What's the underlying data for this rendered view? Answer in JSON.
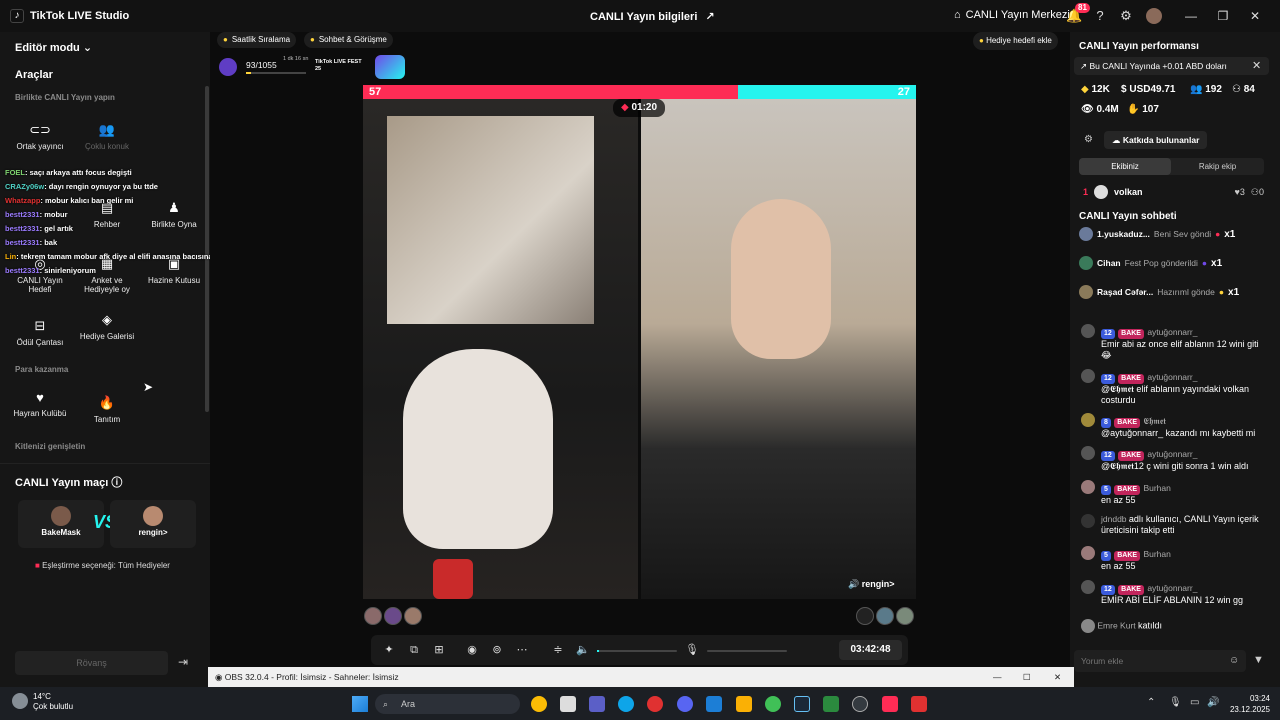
{
  "titlebar": {
    "app_title": "TikTok LIVE Studio",
    "live_info": "CANLI Yayın bilgileri",
    "live_center": "CANLI Yayın Merkezi",
    "notif_count": "81"
  },
  "left": {
    "editor_mode": "Editör modu",
    "tools_heading": "Araçlar",
    "section_live_together": "Birlikte CANLI Yayın yapın",
    "tools": [
      {
        "label": "Ortak yayıncı",
        "icon": "co-host-icon"
      },
      {
        "label": "Çoklu konuk",
        "icon": "multi-guest-icon"
      },
      {
        "label": "Rehber",
        "icon": "guide-icon"
      },
      {
        "label": "Birlikte Oyna",
        "icon": "play-together-icon"
      },
      {
        "label": "CANLI Yayın Hedefi",
        "icon": "live-goal-icon"
      },
      {
        "label": "Anket ve Hediyeyle oy",
        "icon": "poll-icon"
      },
      {
        "label": "Hazine Kutusu",
        "icon": "treasure-box-icon"
      },
      {
        "label": "Ödül Çantası",
        "icon": "reward-bag-icon"
      },
      {
        "label": "Hediye Galerisi",
        "icon": "gift-gallery-icon"
      },
      {
        "label": "Hayran Kulübü",
        "icon": "fan-club-icon"
      },
      {
        "label": "Tanıtım",
        "icon": "promote-icon"
      }
    ],
    "section_monetization": "Para kazanma",
    "section_expand": "Kitlenizi genişletin",
    "overlay_chat": [
      {
        "name": "FOEL",
        "text": ": saçı arkaya attı focus degişti"
      },
      {
        "name": "CRAZy06w",
        "text": ": dayı rengin oynuyor ya bu ttde"
      },
      {
        "name": "Whatzapp",
        "text": ": mobur kalıcı ban gelir mi"
      },
      {
        "name": "bestt2331",
        "text": ": mobur"
      },
      {
        "name": "bestt2331",
        "text": ": gel artık"
      },
      {
        "name": "bestt2331",
        "text": ": bak"
      },
      {
        "name": "Lin",
        "text": ": tekrem tamam mobur afk diye al elifi anasına bacısına sövcem"
      },
      {
        "name": "bestt2331",
        "text": ": sinirleniyorum"
      }
    ],
    "match": {
      "title": "CANLI Yayın maçı",
      "player1": "BakeMask",
      "vs": "VS",
      "player2": "rengin>",
      "pairing": "Eşleştirme seçeneği: Tüm Hediyeler",
      "rematch": "Rövanş"
    }
  },
  "center": {
    "hourly_rank": "Saatlik Sıralama",
    "chat_meet": "Sohbet & Görüşme",
    "gift_goal": "Hediye hedefi ekle",
    "progress_text": "93/1055",
    "progress_time": "1 dk 16 sn",
    "fest_label": "TikTok LIVE FEST 25",
    "battle": {
      "score_left": "57",
      "score_right": "27",
      "timer": "01:20",
      "left_share": 0.6786,
      "opponent_label": "rengin>"
    },
    "duration": "03:42:48",
    "left_color": "#fe2c55",
    "right_color": "#25f4ee"
  },
  "right": {
    "perf_title": "CANLI Yayın performansı",
    "earn_banner": "Bu CANLI Yayında +0.01 ABD doları",
    "stats": {
      "likes": "12K",
      "revenue": "USD49.71",
      "viewers": "192",
      "new_followers": "84",
      "views": "0.4M",
      "gifters": "107"
    },
    "contributors_btn": "Katkıda bulunanlar",
    "tab_ours": "Ekibiniz",
    "tab_rival": "Rakip ekip",
    "top_contributor": {
      "rank": "1",
      "name": "volkan",
      "hearts": "3",
      "people": "0"
    },
    "chat_title": "CANLI Yayın sohbeti",
    "gift_events": [
      {
        "user": "1.yuskaduz...",
        "action": "Beni Sev göndi",
        "count": "x1"
      },
      {
        "user": "Cihan",
        "action": "Fest Pop gönderildi",
        "count": "x1"
      },
      {
        "user": "Raşad Cəfər...",
        "action": "Hazırıml gönde",
        "count": "x1"
      }
    ],
    "messages": [
      {
        "level": "12",
        "fan": "BAKE",
        "user": "aytuğonnarr_",
        "text": "Emir abi az once elif ablanın 12 wini giti 😂"
      },
      {
        "level": "12",
        "fan": "BAKE",
        "user": "aytuğonnarr_",
        "text": "@𝕰𝖍𝖒𝖊𝖙 elif ablanın yayındaki volkan costurdu"
      },
      {
        "level": "8",
        "fan": "BAKE",
        "user": "𝕰𝖍𝖒𝖊𝖙",
        "text": "@aytuğonnarr_ kazandı mı kaybetti mi"
      },
      {
        "level": "12",
        "fan": "BAKE",
        "user": "aytuğonnarr_",
        "text": "@𝕰𝖍𝖒𝖊𝖙12 ç wini giti sonra 1 win aldı"
      },
      {
        "level": "5",
        "fan": "BAKE",
        "user": "Burhan",
        "text": "en az 55"
      },
      {
        "level": "",
        "fan": "",
        "user": "jdnddb",
        "text": "adlı kullanıcı, CANLI Yayın içerik üreticisini takip etti"
      },
      {
        "level": "5",
        "fan": "BAKE",
        "user": "Burhan",
        "text": "en az 55"
      },
      {
        "level": "12",
        "fan": "BAKE",
        "user": "aytuğonnarr_",
        "text": "EMİR ABİ ELİF ABLANIN 12 win gg"
      },
      {
        "level": "",
        "fan": "",
        "user": "Emre Kurt",
        "text": "katıldı"
      }
    ],
    "comment_placeholder": "Yorum ekle"
  },
  "obs": {
    "title": "OBS 32.0.4 - Profil: İsimsiz - Sahneler: İsimsiz"
  },
  "taskbar": {
    "temp": "14°C",
    "weather": "Çok bulutlu",
    "search": "Ara",
    "time": "03:24",
    "date": "23.12.2025"
  }
}
